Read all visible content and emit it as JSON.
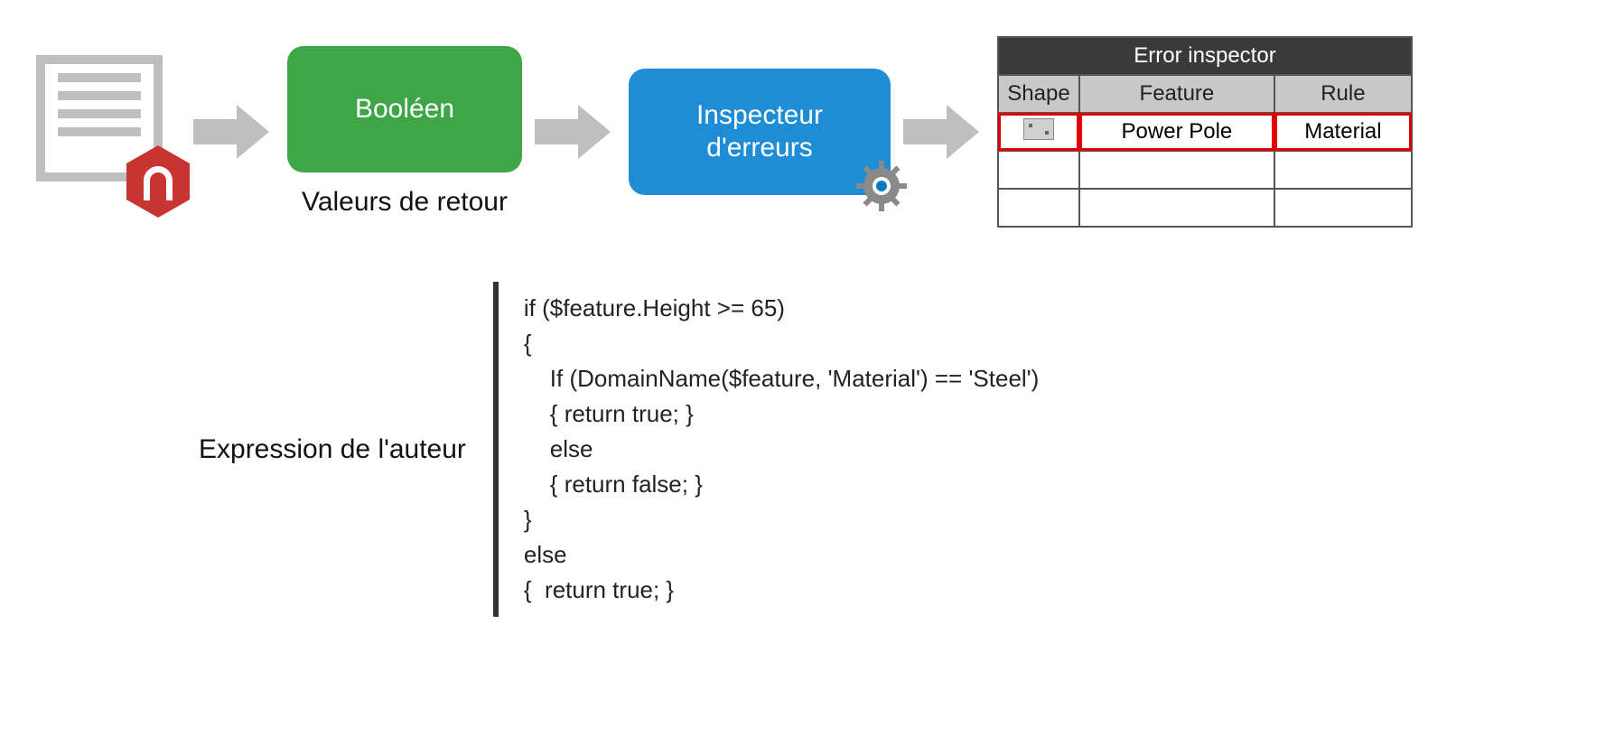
{
  "flow": {
    "booleanLabel": "Booléen",
    "returnValuesCaption": "Valeurs de retour",
    "inspectorLabel": "Inspecteur\nd'erreurs"
  },
  "errorTable": {
    "title": "Error inspector",
    "headers": {
      "shape": "Shape",
      "feature": "Feature",
      "rule": "Rule"
    },
    "rows": [
      {
        "feature": "Power Pole",
        "rule": "Material"
      }
    ]
  },
  "code": {
    "label": "Expression de l'auteur",
    "lines": [
      "if ($feature.Height >= 65)",
      "{",
      "    If (DomainName($feature, 'Material') == 'Steel')",
      "    { return true; }",
      "    else",
      "    { return false; }",
      "}",
      "else",
      "{  return true; }"
    ]
  }
}
